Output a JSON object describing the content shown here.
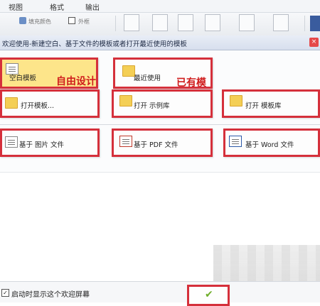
{
  "menu": [
    "视图",
    "格式",
    "输出"
  ],
  "toolbar": {
    "fill_color": "填充颜色",
    "outline": "外框"
  },
  "title_strip": {
    "text": "欢迎使用-新建空白、基于文件的模板或者打开最近使用的模板",
    "close": "×"
  },
  "tiles": [
    {
      "label": "空白模板",
      "annotation": "自由设计"
    },
    {
      "label": "最近使用",
      "annotation": "已有模板"
    },
    {
      "label": "打开模板..."
    },
    {
      "label": "打开 示例库"
    },
    {
      "label": "打开 模板库"
    },
    {
      "label": "基于 图片 文件"
    },
    {
      "label": "基于 PDF 文件"
    },
    {
      "label": "基于 Word 文件"
    }
  ],
  "footer": {
    "checkbox_label": "启动时显示这个欢迎屏幕",
    "checked": true,
    "check_mark": "✓",
    "ok_mark": "✔"
  },
  "colors": {
    "highlight_border": "#d5303b",
    "annotation": "#d01c1c",
    "selected_tile": "#fde58a"
  }
}
